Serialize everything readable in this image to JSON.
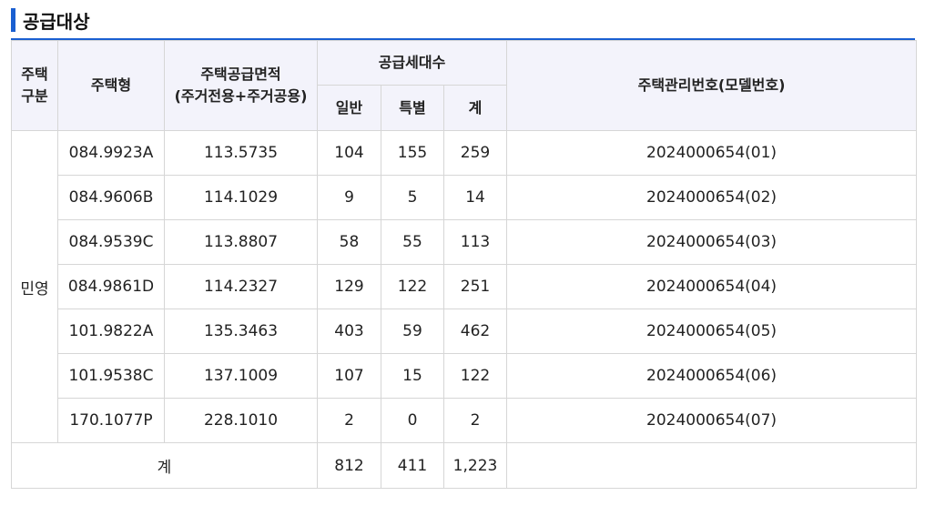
{
  "section": {
    "title": "공급대상"
  },
  "header": {
    "type_category_line1": "주택",
    "type_category_line2": "구분",
    "house_type": "주택형",
    "supply_area_line1": "주택공급면적",
    "supply_area_line2": "(주거전용+주거공용)",
    "supply_units": "공급세대수",
    "general": "일반",
    "special": "특별",
    "total": "계",
    "management_no": "주택관리번호(모델번호)"
  },
  "category": "민영",
  "rows": [
    {
      "house_type": "084.9923A",
      "area": "113.5735",
      "general": "104",
      "special": "155",
      "total": "259",
      "management_no": "2024000654(01)"
    },
    {
      "house_type": "084.9606B",
      "area": "114.1029",
      "general": "9",
      "special": "5",
      "total": "14",
      "management_no": "2024000654(02)"
    },
    {
      "house_type": "084.9539C",
      "area": "113.8807",
      "general": "58",
      "special": "55",
      "total": "113",
      "management_no": "2024000654(03)"
    },
    {
      "house_type": "084.9861D",
      "area": "114.2327",
      "general": "129",
      "special": "122",
      "total": "251",
      "management_no": "2024000654(04)"
    },
    {
      "house_type": "101.9822A",
      "area": "135.3463",
      "general": "403",
      "special": "59",
      "total": "462",
      "management_no": "2024000654(05)"
    },
    {
      "house_type": "101.9538C",
      "area": "137.1009",
      "general": "107",
      "special": "15",
      "total": "122",
      "management_no": "2024000654(06)"
    },
    {
      "house_type": "170.1077P",
      "area": "228.1010",
      "general": "2",
      "special": "0",
      "total": "2",
      "management_no": "2024000654(07)"
    }
  ],
  "totals": {
    "label": "계",
    "general": "812",
    "special": "411",
    "total": "1,223",
    "management_no": ""
  },
  "colors": {
    "accent": "#1a5fd1",
    "header_bg": "#f3f3fb",
    "border": "#d6d6d6"
  }
}
